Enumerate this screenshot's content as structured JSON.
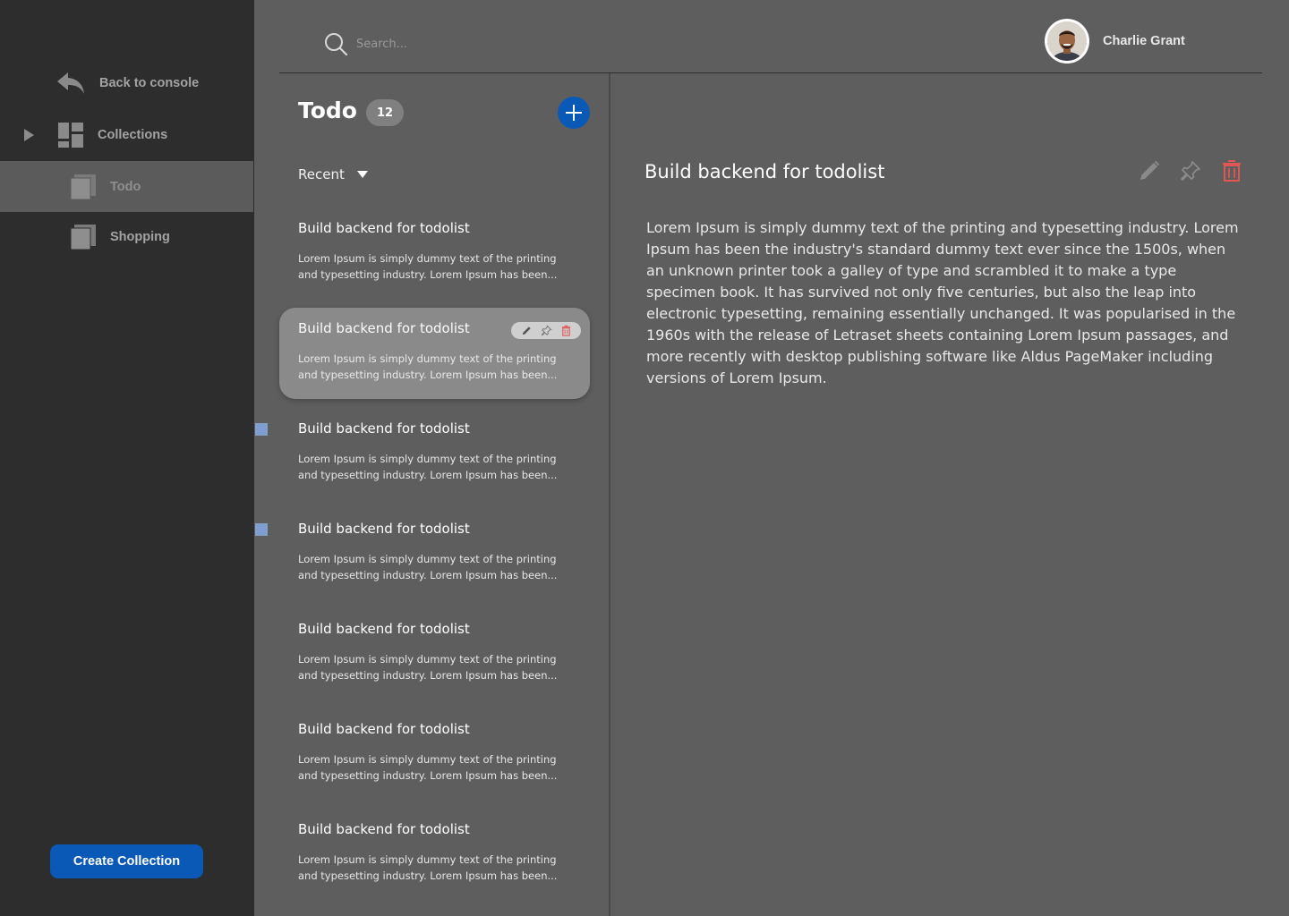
{
  "sidebar": {
    "back_label": "Back to console",
    "collections_label": "Collections",
    "items": [
      {
        "label": "Todo"
      },
      {
        "label": "Shopping"
      }
    ],
    "create_label": "Create Collection"
  },
  "header": {
    "search_placeholder": "Search...",
    "user_name": "Charlie Grant"
  },
  "list": {
    "title": "Todo",
    "count": "12",
    "sort_label": "Recent",
    "items": [
      {
        "title": "Build backend for todolist",
        "desc": "Lorem Ipsum is simply dummy text of the printing and typesetting industry. Lorem Ipsum has been..."
      },
      {
        "title": "Build backend for todolist",
        "desc": "Lorem Ipsum is simply dummy text of the printing and typesetting industry. Lorem Ipsum has been..."
      },
      {
        "title": "Build backend for todolist",
        "desc": "Lorem Ipsum is simply dummy text of the printing and typesetting industry. Lorem Ipsum has been..."
      },
      {
        "title": "Build backend for todolist",
        "desc": "Lorem Ipsum is simply dummy text of the printing and typesetting industry. Lorem Ipsum has been..."
      },
      {
        "title": "Build backend for todolist",
        "desc": "Lorem Ipsum is simply dummy text of the printing and typesetting industry. Lorem Ipsum has been..."
      },
      {
        "title": "Build backend for todolist",
        "desc": "Lorem Ipsum is simply dummy text of the printing and typesetting industry. Lorem Ipsum has been..."
      },
      {
        "title": "Build backend for todolist",
        "desc": "Lorem Ipsum is simply dummy text of the printing and typesetting industry. Lorem Ipsum has been..."
      }
    ]
  },
  "detail": {
    "title": "Build backend for todolist",
    "body": "Lorem Ipsum is simply dummy text of the printing and typesetting industry. Lorem Ipsum has been the industry's standard dummy text ever since the 1500s, when an unknown printer took a galley of type and scrambled it to make a type specimen book. It has survived not only five centuries, but also the leap into electronic typesetting, remaining essentially unchanged. It was popularised in the 1960s with the release of Letraset sheets containing Lorem Ipsum passages, and more recently with desktop publishing software like Aldus PageMaker including versions of Lorem Ipsum."
  },
  "colors": {
    "accent": "#0a59b7",
    "sidebar_bg": "#2d2d2d",
    "main_bg": "#5e5e5e",
    "delete": "#e05555",
    "marker": "#7f9fd0"
  },
  "icons": {
    "back": "reply-arrow-icon",
    "collections": "dashboard-icon",
    "collection_item": "stacked-squares-icon",
    "search": "search-icon",
    "add": "plus-icon",
    "edit": "pencil-icon",
    "pin": "pin-icon",
    "delete": "trash-icon"
  }
}
